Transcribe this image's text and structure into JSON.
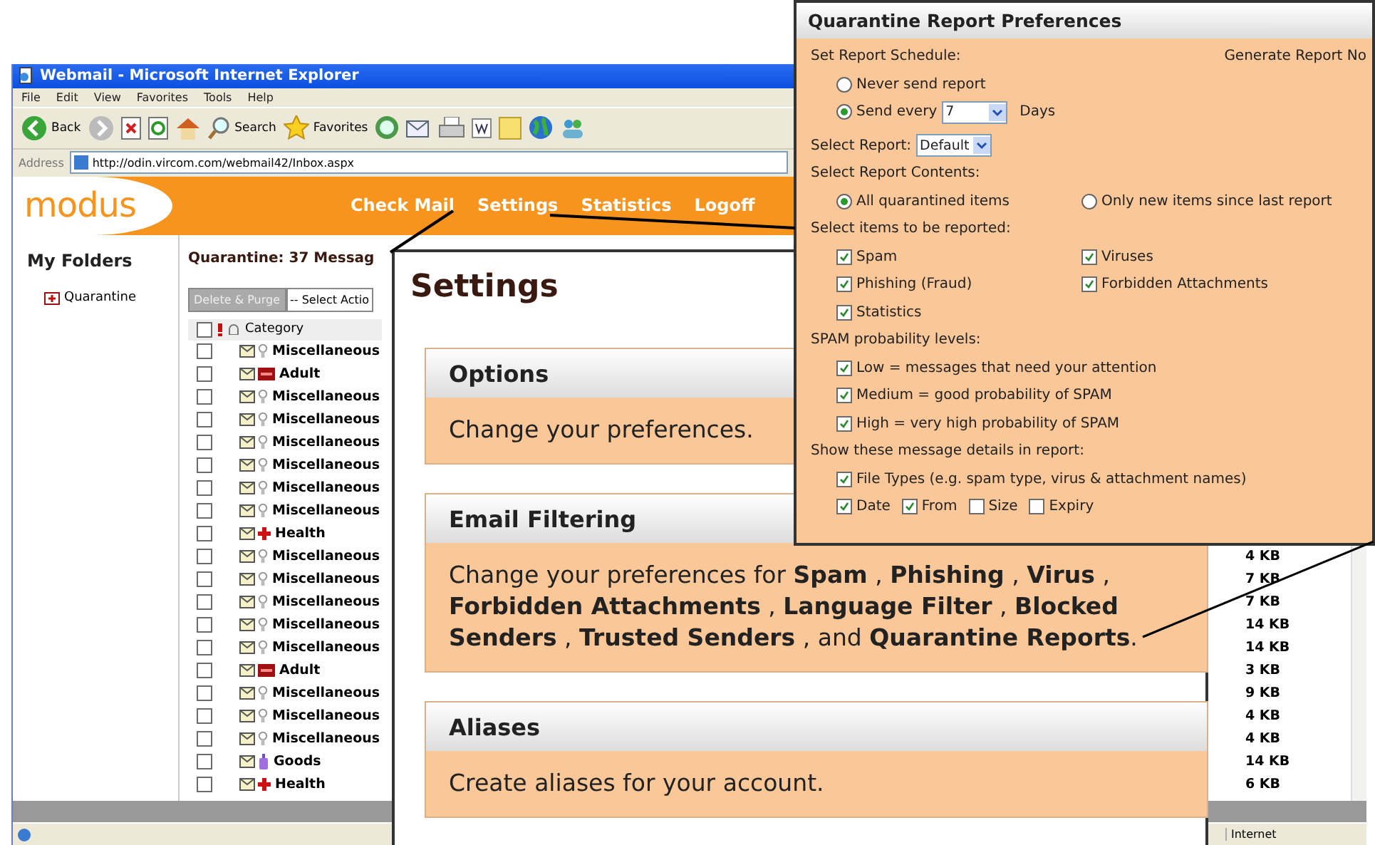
{
  "browser": {
    "title": "Webmail - Microsoft Internet Explorer",
    "menu": [
      "File",
      "Edit",
      "View",
      "Favorites",
      "Tools",
      "Help"
    ],
    "toolbar": {
      "back": "Back",
      "search": "Search",
      "favorites": "Favorites"
    },
    "address_label": "Address",
    "url": "http://odin.vircom.com/webmail42/Inbox.aspx",
    "status": "Internet"
  },
  "header": {
    "logo": "modus",
    "nav": [
      "Check Mail",
      "Settings",
      "Statistics",
      "Logoff"
    ]
  },
  "sidebar": {
    "title": "My Folders",
    "folders": [
      "Quarantine"
    ]
  },
  "quarantine": {
    "heading": "Quarantine: 37 Messag",
    "purge_button": "Delete & Purge",
    "action_select": "-- Select Actio",
    "column": "Category",
    "select_all_checked": false,
    "rows": [
      {
        "kind": "misc",
        "category": "Miscellaneous",
        "checked": false
      },
      {
        "kind": "adult",
        "category": "Adult",
        "checked": false
      },
      {
        "kind": "misc",
        "category": "Miscellaneous",
        "checked": false
      },
      {
        "kind": "misc",
        "category": "Miscellaneous",
        "checked": false
      },
      {
        "kind": "misc",
        "category": "Miscellaneous",
        "checked": false
      },
      {
        "kind": "misc",
        "category": "Miscellaneous",
        "checked": false
      },
      {
        "kind": "misc",
        "category": "Miscellaneous",
        "checked": false
      },
      {
        "kind": "misc",
        "category": "Miscellaneous",
        "checked": false
      },
      {
        "kind": "health",
        "category": "Health",
        "checked": false
      },
      {
        "kind": "misc",
        "category": "Miscellaneous",
        "checked": false,
        "size": "4 KB"
      },
      {
        "kind": "misc",
        "category": "Miscellaneous",
        "checked": false,
        "size": "7 KB"
      },
      {
        "kind": "misc",
        "category": "Miscellaneous",
        "checked": false,
        "size": "7 KB"
      },
      {
        "kind": "misc",
        "category": "Miscellaneous",
        "checked": false,
        "size": "14 KB"
      },
      {
        "kind": "misc",
        "category": "Miscellaneous",
        "checked": false,
        "size": "14 KB"
      },
      {
        "kind": "adult",
        "category": "Adult",
        "checked": false,
        "size": "3 KB"
      },
      {
        "kind": "misc",
        "category": "Miscellaneous",
        "checked": false,
        "size": "9 KB"
      },
      {
        "kind": "misc",
        "category": "Miscellaneous",
        "checked": false,
        "size": "4 KB"
      },
      {
        "kind": "misc",
        "category": "Miscellaneous",
        "checked": false,
        "size": "4 KB"
      },
      {
        "kind": "goods",
        "category": "Goods",
        "checked": false,
        "size": "14 KB"
      },
      {
        "kind": "health",
        "category": "Health",
        "checked": false,
        "size": "6 KB"
      }
    ]
  },
  "settings_panel": {
    "title": "Settings",
    "sections": [
      {
        "title": "Options",
        "text": "Change your preferences."
      },
      {
        "title": "Email Filtering",
        "text": "Change your preferences for **Spam** , **Phishing** , **Virus** , **Forbidden Attachments** , **Language Filter** , **Blocked Senders** , **Trusted Senders** , and **Quarantine Reports**."
      },
      {
        "title": "Aliases",
        "text": "Create aliases for your account."
      }
    ]
  },
  "preferences_panel": {
    "title": "Quarantine Report Preferences",
    "schedule_label": "Set Report Schedule:",
    "generate_link": "Generate Report No",
    "schedule_options": [
      {
        "label": "Never send report",
        "selected": false
      },
      {
        "label": "Send every",
        "selected": true,
        "value": "7",
        "unit": "Days"
      }
    ],
    "report_label": "Select Report:",
    "report_value": "Default",
    "contents_label": "Select Report Contents:",
    "contents_options": [
      {
        "label": "All quarantined items",
        "selected": true
      },
      {
        "label": "Only new items since last report",
        "selected": false
      }
    ],
    "items_label": "Select items to be reported:",
    "items": [
      {
        "label": "Spam",
        "checked": true
      },
      {
        "label": "Viruses",
        "checked": true
      },
      {
        "label": "Phishing (Fraud)",
        "checked": true
      },
      {
        "label": "Forbidden Attachments",
        "checked": true
      },
      {
        "label": "Statistics",
        "checked": true
      }
    ],
    "levels_label": "SPAM probability levels:",
    "levels": [
      {
        "label": "Low = messages that need your attention",
        "checked": true
      },
      {
        "label": "Medium = good probability of SPAM",
        "checked": true
      },
      {
        "label": "High = very high probability of SPAM",
        "checked": true
      }
    ],
    "details_label": "Show these message details in report:",
    "file_types": {
      "label": "File Types (e.g. spam type, virus & attachment names)",
      "checked": true
    },
    "details": [
      {
        "label": "Date",
        "checked": true
      },
      {
        "label": "From",
        "checked": true
      },
      {
        "label": "Size",
        "checked": false
      },
      {
        "label": "Expiry",
        "checked": false
      }
    ]
  }
}
